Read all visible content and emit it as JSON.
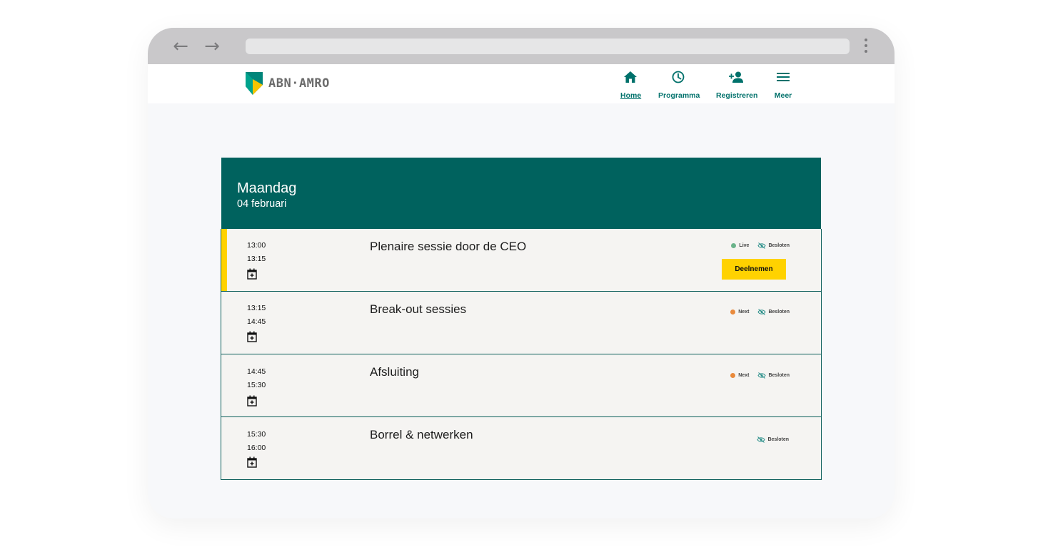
{
  "header": {
    "logo_text": "ABN·AMRO",
    "nav": [
      {
        "label": "Home",
        "icon": "home-icon",
        "active": true
      },
      {
        "label": "Programma",
        "icon": "clock-icon",
        "active": false
      },
      {
        "label": "Registreren",
        "icon": "add-person-icon",
        "active": false
      },
      {
        "label": "Meer",
        "icon": "menu-icon",
        "active": false
      }
    ]
  },
  "day": {
    "name": "Maandag",
    "date": "04 februari"
  },
  "sessions": [
    {
      "start": "13:00",
      "end": "13:15",
      "title": "Plenaire sessie door de CEO",
      "status": "Live",
      "access": "Besloten",
      "action": "Deelnemen"
    },
    {
      "start": "13:15",
      "end": "14:45",
      "title": "Break-out sessies",
      "status": "Next",
      "access": "Besloten"
    },
    {
      "start": "14:45",
      "end": "15:30",
      "title": "Afsluiting",
      "status": "Next",
      "access": "Besloten"
    },
    {
      "start": "15:30",
      "end": "16:00",
      "title": "Borrel & netwerken",
      "access": "Besloten"
    }
  ],
  "colors": {
    "brand_teal": "#00625e",
    "accent_yellow": "#ffd200",
    "live_green": "#6bb38a",
    "next_orange": "#e98a3c"
  }
}
